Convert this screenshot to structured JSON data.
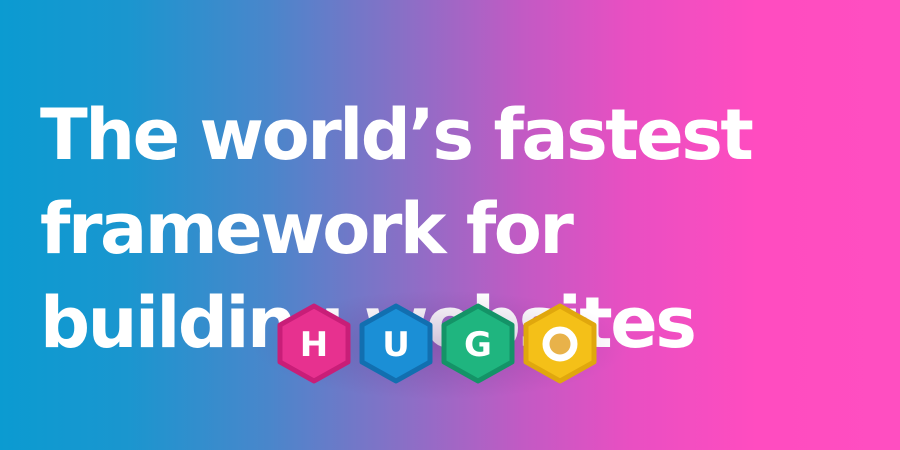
{
  "headline": {
    "lines": [
      "The world’s fastest",
      "framework for",
      "building websites"
    ]
  },
  "logo": {
    "letters": [
      "H",
      "U",
      "G",
      "O"
    ],
    "hex_colors": [
      "#e7318f",
      "#1b8fd6",
      "#1fb57f",
      "#f4c018"
    ],
    "hex_border_colors": [
      "#c81e78",
      "#126fb0",
      "#149367",
      "#e0a70d"
    ],
    "icons": [
      "hexagon-h",
      "hexagon-u",
      "hexagon-g",
      "hexagon-o"
    ]
  }
}
